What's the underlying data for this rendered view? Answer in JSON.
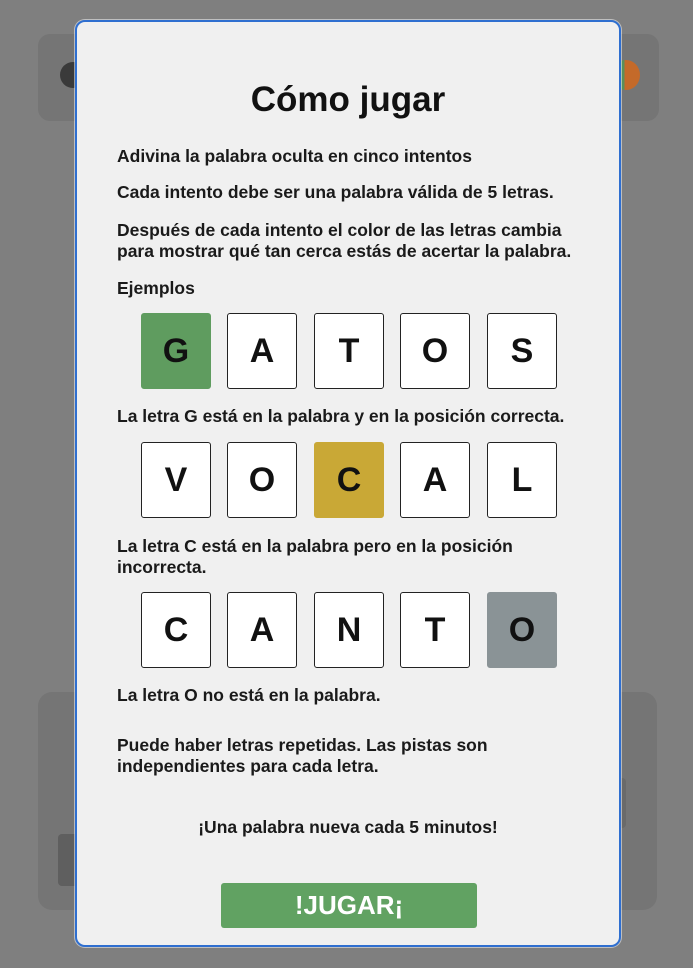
{
  "modal": {
    "title": "Cómo jugar",
    "intro_1": "Adivina la palabra oculta en cinco intentos",
    "intro_2": "Cada intento debe ser una palabra válida de 5 letras.",
    "intro_3": "Después de cada intento el color de las letras cambia para mostrar qué tan cerca estás de acertar la palabra.",
    "examples_heading": "Ejemplos",
    "examples": [
      {
        "letters": [
          "G",
          "A",
          "T",
          "O",
          "S"
        ],
        "states": [
          "correct",
          "empty",
          "empty",
          "empty",
          "empty"
        ],
        "explanation": "La letra G está en la palabra y en la posición correcta."
      },
      {
        "letters": [
          "V",
          "O",
          "C",
          "A",
          "L"
        ],
        "states": [
          "empty",
          "empty",
          "present",
          "empty",
          "empty"
        ],
        "explanation": "La letra C está en la palabra pero en la posición incorrecta."
      },
      {
        "letters": [
          "C",
          "A",
          "N",
          "T",
          "O"
        ],
        "states": [
          "empty",
          "empty",
          "empty",
          "empty",
          "absent"
        ],
        "explanation": "La letra O no está en la palabra."
      }
    ],
    "repeated_note": "Puede haber letras repetidas. Las pistas son independientes para cada letra.",
    "tagline": "¡Una palabra nueva cada 5 minutos!",
    "play_label": "!JUGAR¡"
  },
  "colors": {
    "correct": "#5f9c5f",
    "present": "#c9a836",
    "absent": "#8a9396",
    "play_button": "#61a262",
    "modal_border": "#2f6fd0"
  },
  "background": {
    "help_icon": "help-icon",
    "avatar_icon": "avatar-icon"
  }
}
